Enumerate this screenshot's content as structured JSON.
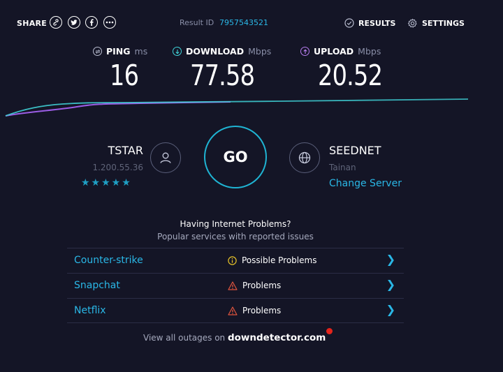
{
  "topbar": {
    "share_label": "SHARE",
    "share_icons": [
      "link-icon",
      "twitter-icon",
      "facebook-icon",
      "more-icon"
    ],
    "result_label": "Result ID",
    "result_id": "7957543521",
    "results_label": "RESULTS",
    "settings_label": "SETTINGS"
  },
  "metrics": {
    "ping": {
      "label": "PING",
      "unit": "ms",
      "value": "16"
    },
    "download": {
      "label": "DOWNLOAD",
      "unit": "Mbps",
      "value": "77.58"
    },
    "upload": {
      "label": "UPLOAD",
      "unit": "Mbps",
      "value": "20.52"
    }
  },
  "colors": {
    "background": "#141526",
    "accent_cyan": "#2ab7e6",
    "download_line": "#3fd1d6",
    "upload_line": "#9b5de5",
    "warning_red": "#e4241b"
  },
  "go": {
    "label": "GO"
  },
  "isp": {
    "name": "TSTAR",
    "ip": "1.200.55.36",
    "rating_stars": 5,
    "stars_text": "★★★★★"
  },
  "server": {
    "name": "SEEDNET",
    "city": "Tainan",
    "change_label": "Change Server"
  },
  "problems": {
    "title": "Having Internet Problems?",
    "subtitle": "Popular services with reported issues",
    "rows": [
      {
        "service": "Counter-strike",
        "status": "Possible Problems",
        "icon": "info-icon"
      },
      {
        "service": "Snapchat",
        "status": "Problems",
        "icon": "warning-icon"
      },
      {
        "service": "Netflix",
        "status": "Problems",
        "icon": "warning-icon"
      }
    ],
    "footer_prefix": "View all outages on",
    "footer_brand": "downdetector.com"
  }
}
